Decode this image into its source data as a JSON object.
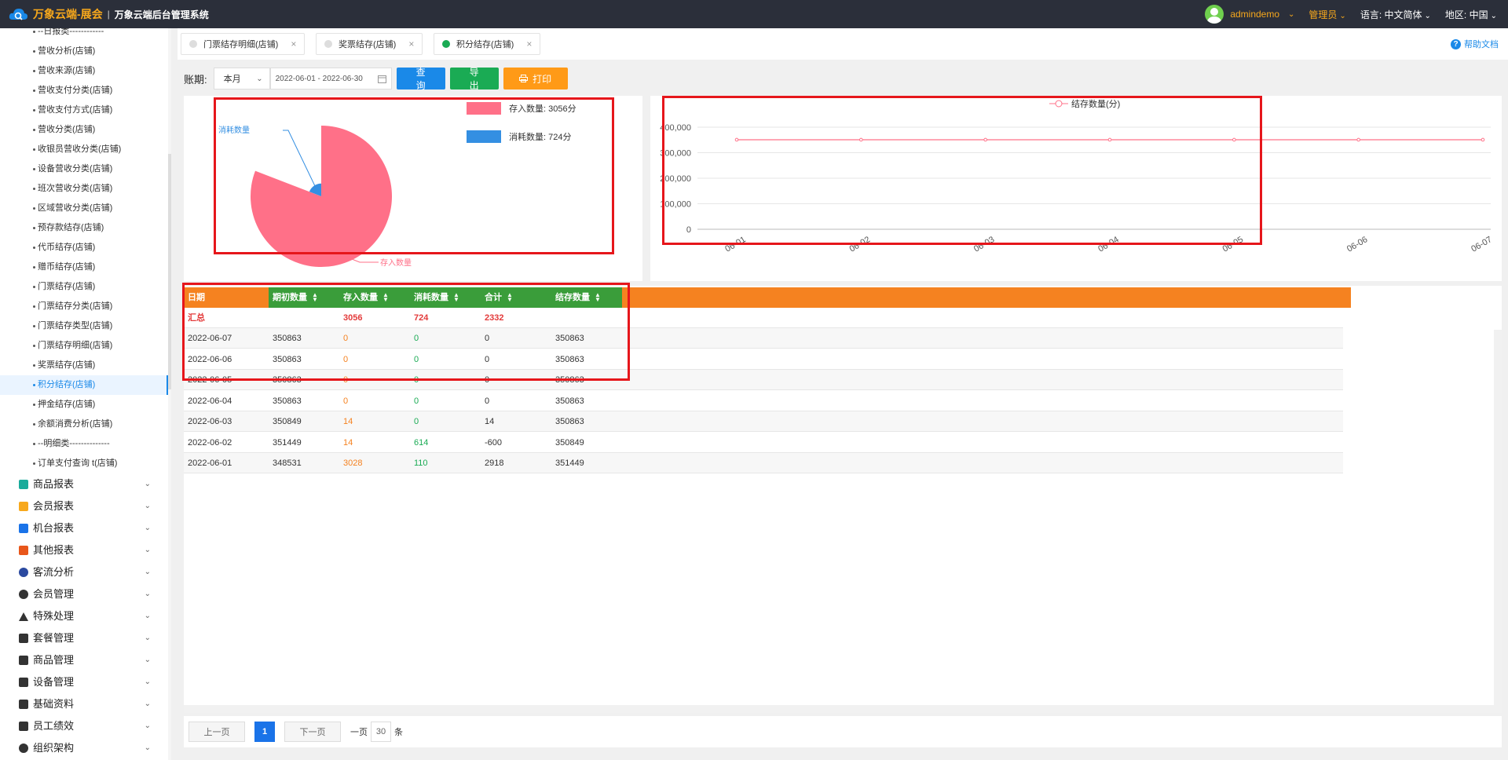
{
  "header": {
    "brand": "万象云端-展会",
    "system": "万象云端后台管理系统",
    "user": "admindemo",
    "role": "管理员",
    "language_label": "语言:",
    "language": "中文简体",
    "region_label": "地区:",
    "region": "中国"
  },
  "sidebar": {
    "sub_items": [
      "--日报类------------",
      "营收分析(店铺)",
      "营收来源(店铺)",
      "营收支付分类(店铺)",
      "营收支付方式(店铺)",
      "营收分类(店铺)",
      "收银员营收分类(店铺)",
      "设备营收分类(店铺)",
      "班次营收分类(店铺)",
      "区域营收分类(店铺)",
      "预存款结存(店铺)",
      "代币结存(店铺)",
      "赠币结存(店铺)",
      "门票结存(店铺)",
      "门票结存分类(店铺)",
      "门票结存类型(店铺)",
      "门票结存明细(店铺)",
      "奖票结存(店铺)",
      "积分结存(店铺)",
      "押金结存(店铺)",
      "余额消费分析(店铺)",
      "--明细类--------------",
      "订单支付查询 t(店铺)"
    ],
    "active_index": 18,
    "groups": [
      {
        "label": "商品报表",
        "icon": "product-report-icon",
        "color": "#1aab9b"
      },
      {
        "label": "会员报表",
        "icon": "member-report-icon",
        "color": "#f7a81c"
      },
      {
        "label": "机台报表",
        "icon": "machine-report-icon",
        "color": "#1a73e8"
      },
      {
        "label": "其他报表",
        "icon": "layers-icon",
        "color": "#e8561a"
      },
      {
        "label": "客流分析",
        "icon": "target-icon",
        "color": "#2b4aa0"
      },
      {
        "label": "会员管理",
        "icon": "user-icon",
        "color": "#333333"
      },
      {
        "label": "特殊处理",
        "icon": "warning-icon",
        "color": "#333333"
      },
      {
        "label": "套餐管理",
        "icon": "edit-icon",
        "color": "#333333"
      },
      {
        "label": "商品管理",
        "icon": "swap-icon",
        "color": "#333333"
      },
      {
        "label": "设备管理",
        "icon": "tool-icon",
        "color": "#333333"
      },
      {
        "label": "基础资料",
        "icon": "file-icon",
        "color": "#333333"
      },
      {
        "label": "员工绩效",
        "icon": "gear-icon",
        "color": "#333333"
      },
      {
        "label": "组织架构",
        "icon": "org-icon",
        "color": "#333333"
      }
    ]
  },
  "tabs": [
    {
      "label": "门票结存明细(店铺)",
      "active": false
    },
    {
      "label": "奖票结存(店铺)",
      "active": false
    },
    {
      "label": "积分结存(店铺)",
      "active": true
    }
  ],
  "help_label": "帮助文档",
  "filter": {
    "label": "账期:",
    "period": "本月",
    "date_range": "2022-06-01 - 2022-06-30",
    "query": "查询",
    "export": "导出",
    "print": "打印"
  },
  "chart_data": [
    {
      "type": "pie",
      "categories": [
        "存入数量",
        "消耗数量"
      ],
      "values": [
        3056,
        724
      ],
      "colors": [
        "#ff7088",
        "#348fe2"
      ],
      "legend": [
        "存入数量: 3056分",
        "消耗数量: 724分"
      ]
    },
    {
      "type": "line",
      "series": [
        {
          "name": "结存数量(分)",
          "values": [
            350863,
            350863,
            350863,
            350863,
            350863,
            350863,
            350863
          ]
        }
      ],
      "x": [
        "06-01",
        "06-02",
        "06-03",
        "06-04",
        "06-05",
        "06-06",
        "06-07"
      ],
      "yticks": [
        "0",
        "100,000",
        "200,000",
        "300,000",
        "400,000"
      ],
      "ylim": [
        0,
        400000
      ],
      "color": "#ff7088"
    }
  ],
  "table": {
    "headers": [
      "日期",
      "期初数量",
      "存入数量",
      "消耗数量",
      "合计",
      "结存数量"
    ],
    "summary": [
      "汇总",
      "",
      "3056",
      "724",
      "2332",
      ""
    ],
    "rows": [
      [
        "2022-06-07",
        "350863",
        "0",
        "0",
        "0",
        "350863"
      ],
      [
        "2022-06-06",
        "350863",
        "0",
        "0",
        "0",
        "350863"
      ],
      [
        "2022-06-05",
        "350863",
        "0",
        "0",
        "0",
        "350863"
      ],
      [
        "2022-06-04",
        "350863",
        "0",
        "0",
        "0",
        "350863"
      ],
      [
        "2022-06-03",
        "350849",
        "14",
        "0",
        "14",
        "350863"
      ],
      [
        "2022-06-02",
        "351449",
        "14",
        "614",
        "-600",
        "350849"
      ],
      [
        "2022-06-01",
        "348531",
        "3028",
        "110",
        "2918",
        "351449"
      ]
    ]
  },
  "pager": {
    "prev": "上一页",
    "page": "1",
    "next": "下一页",
    "per_page_label": "一页",
    "per_page": "30",
    "unit": "条"
  }
}
